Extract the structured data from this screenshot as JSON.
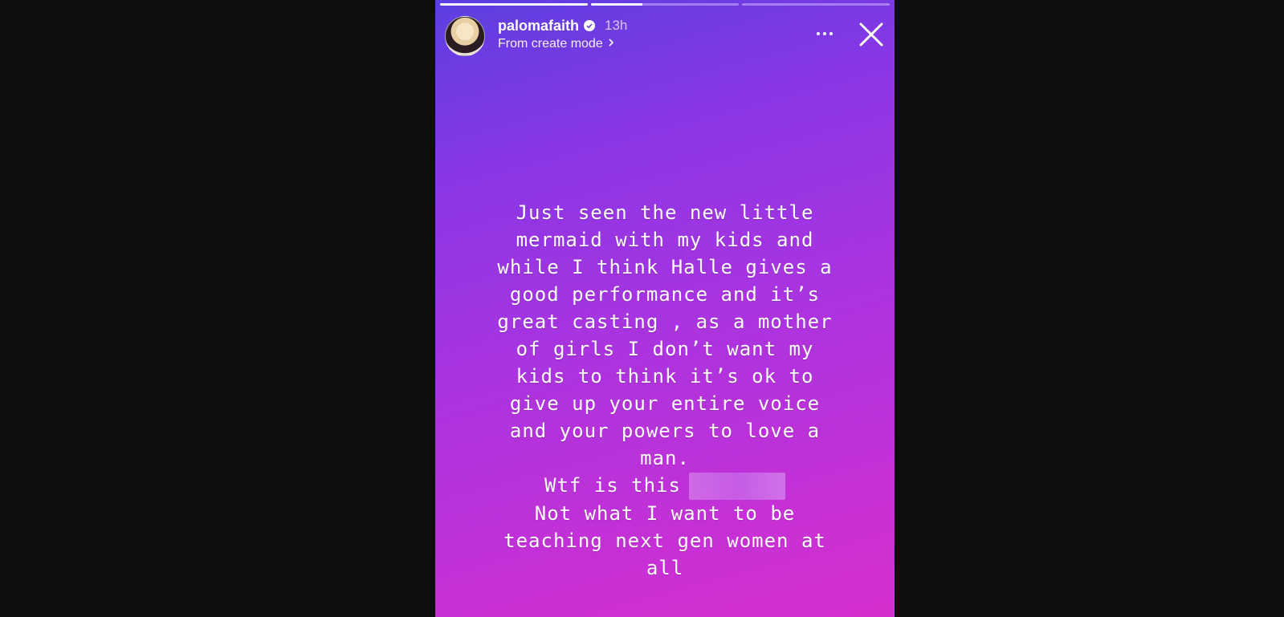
{
  "story": {
    "progress": [
      1.0,
      0.35,
      0.0
    ],
    "colors": {
      "gradient_start": "#5b3fe0",
      "gradient_end": "#d72fcf",
      "background": "#0e0e0e"
    },
    "header": {
      "username": "palomafaith",
      "verified_icon": "verified-badge-icon",
      "time": "13h",
      "subtitle": "From create mode",
      "subtitle_icon": "chevron-right-icon",
      "more_icon": "more-horizontal-icon",
      "close_icon": "close-icon"
    },
    "caption": {
      "lines": [
        "Just seen the new little",
        "mermaid with my kids and",
        "while I think Halle gives a",
        "good performance and it’s",
        "great casting , as a mother",
        "of girls I don’t want my",
        "kids to think it’s ok to",
        "give up your entire voice",
        "and your powers to love a",
        "man.",
        "Wtf is this",
        "Not what I want to be",
        "teaching next gen women at",
        "all"
      ]
    }
  }
}
